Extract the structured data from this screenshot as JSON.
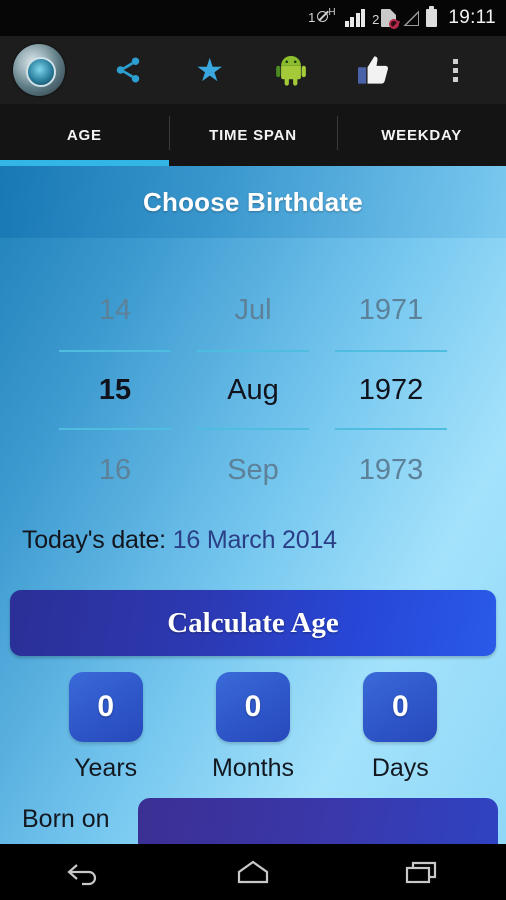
{
  "status_bar": {
    "sim1_label": "1",
    "sim1_network": "H",
    "sim2_label": "2",
    "time": "19:11",
    "icons": [
      "sim1-data-icon",
      "signal-bars-icon",
      "sim2-blocked-icon",
      "signal-empty-icon",
      "battery-icon"
    ]
  },
  "action_bar": {
    "logo": "app-logo-icon",
    "buttons": [
      {
        "name": "share-icon",
        "label": "Share"
      },
      {
        "name": "star-icon",
        "label": "Rate"
      },
      {
        "name": "android-icon",
        "label": "More Apps"
      },
      {
        "name": "thumbs-up-icon",
        "label": "Like"
      },
      {
        "name": "overflow-menu-icon",
        "label": "More options"
      }
    ]
  },
  "tabs": [
    {
      "label": "AGE",
      "active": true
    },
    {
      "label": "TIME SPAN",
      "active": false
    },
    {
      "label": "WEEKDAY",
      "active": false
    }
  ],
  "header": {
    "title": "Choose Birthdate"
  },
  "date_picker": {
    "day": {
      "previous": "14",
      "selected": "15",
      "next": "16"
    },
    "month": {
      "previous": "Jul",
      "selected": "Aug",
      "next": "Sep"
    },
    "year": {
      "previous": "1971",
      "selected": "1972",
      "next": "1973"
    }
  },
  "today": {
    "label": "Today's date:",
    "value": "16 March 2014"
  },
  "calculate_button": {
    "label": "Calculate Age"
  },
  "results": [
    {
      "value": "0",
      "label": "Years"
    },
    {
      "value": "0",
      "label": "Months"
    },
    {
      "value": "0",
      "label": "Days"
    }
  ],
  "born_on": {
    "label": "Born on",
    "value": ""
  },
  "nav_bar": {
    "back": "back-icon",
    "home": "home-icon",
    "recents": "recents-icon"
  },
  "colors": {
    "tab_accent": "#33b5e5",
    "picker_divider": "#4fbde0",
    "result_box": "#2d55c8",
    "calculate_button": "#2747d8",
    "today_value": "#2a3f86"
  }
}
